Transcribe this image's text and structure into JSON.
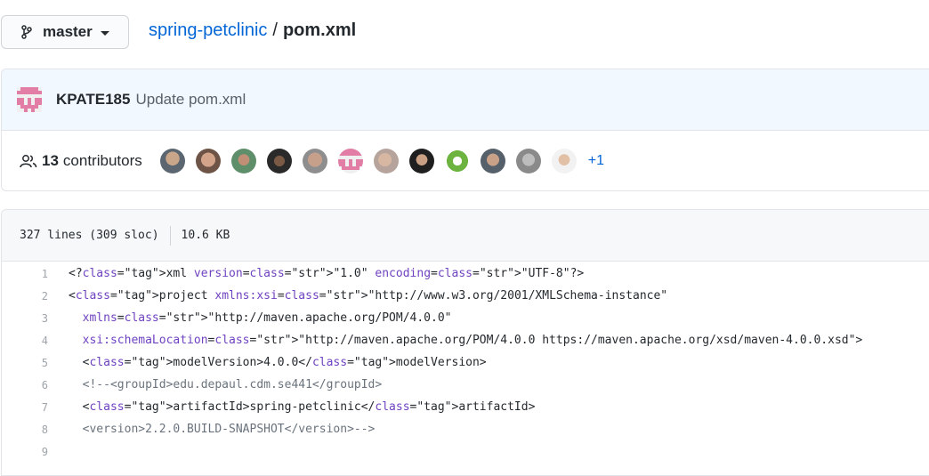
{
  "branch": {
    "name": "master",
    "icon": "git-branch-icon"
  },
  "breadcrumb": {
    "repo": "spring-petclinic",
    "separator": "/",
    "file": "pom.xml"
  },
  "commit": {
    "author": "KPATE185",
    "message": "Update pom.xml"
  },
  "contributors": {
    "count": "13",
    "label": "contributors",
    "more": "+1",
    "icon": "people-icon"
  },
  "file_info": {
    "lines": "327 lines (309 sloc)",
    "size": "10.6 KB"
  },
  "code_lines": [
    {
      "n": "1",
      "t": "<?xml version=\"1.0\" encoding=\"UTF-8\"?>"
    },
    {
      "n": "2",
      "t": "<project xmlns:xsi=\"http://www.w3.org/2001/XMLSchema-instance\""
    },
    {
      "n": "3",
      "t": "  xmlns=\"http://maven.apache.org/POM/4.0.0\""
    },
    {
      "n": "4",
      "t": "  xsi:schemaLocation=\"http://maven.apache.org/POM/4.0.0 https://maven.apache.org/xsd/maven-4.0.0.xsd\">"
    },
    {
      "n": "5",
      "t": "  <modelVersion>4.0.0</modelVersion>"
    },
    {
      "n": "6",
      "t": "  <!--<groupId>edu.depaul.cdm.se441</groupId>"
    },
    {
      "n": "7",
      "t": "  <artifactId>spring-petclinic</artifactId>"
    },
    {
      "n": "8",
      "t": "  <version>2.2.0.BUILD-SNAPSHOT</version>-->"
    },
    {
      "n": "9",
      "t": ""
    }
  ],
  "colors": {
    "link": "#0366d6",
    "tag": "#22863a",
    "attr": "#6f42c1",
    "string": "#032f62",
    "comment": "#6a737d"
  }
}
